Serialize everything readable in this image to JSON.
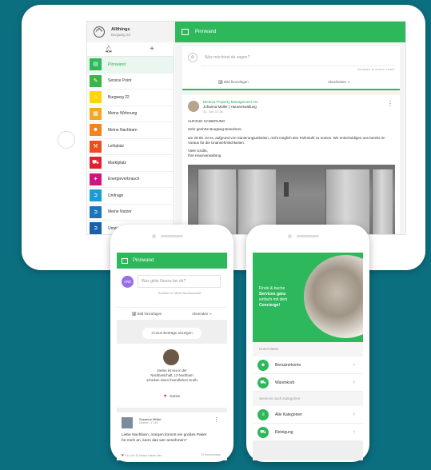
{
  "tablet": {
    "community_name": "Allthings",
    "community_address": "Burgweg 22",
    "nav_items": [
      {
        "label": "Pinnwand",
        "icon": "bulletin-icon",
        "color": "#2eb85c",
        "glyph": "▤"
      },
      {
        "label": "Service Point",
        "icon": "service-icon",
        "color": "#39b54a",
        "glyph": "✎"
      },
      {
        "label": "Burgweg 22",
        "icon": "house-icon",
        "color": "#ffd500",
        "glyph": "⌂"
      },
      {
        "label": "Meine Wohnung",
        "icon": "apartment-icon",
        "color": "#f5a623",
        "glyph": "▦"
      },
      {
        "label": "Meine Nachbarn",
        "icon": "neighbors-icon",
        "color": "#f58220",
        "glyph": "☻"
      },
      {
        "label": "Leihplatz",
        "icon": "lending-icon",
        "color": "#e94e1b",
        "glyph": "⚒"
      },
      {
        "label": "Marktplatz",
        "icon": "market-icon",
        "color": "#e5202e",
        "glyph": "⛟"
      },
      {
        "label": "Energieverbrauch",
        "icon": "energy-icon",
        "color": "#d0157f",
        "glyph": "✦"
      },
      {
        "label": "Umfrage",
        "icon": "survey-icon",
        "color": "#1c9bd7",
        "glyph": "➲"
      },
      {
        "label": "Meine Nutzer",
        "icon": "users-icon",
        "color": "#1b75bc",
        "glyph": "➲"
      },
      {
        "label": "Umzug & B",
        "icon": "move-icon",
        "color": "#1b5fa8",
        "glyph": "➲"
      }
    ],
    "header_title": "Pinnwand",
    "composer": {
      "placeholder": "Was möchtest du sagen?",
      "scope": "Schicken 'in einer/n Listen'",
      "photo": "Bild hinzufügen",
      "send": "Abschicken"
    },
    "post": {
      "org": "Beneva Property Management AG",
      "author": "Johanna Müller | Hausverwaltung",
      "date": "31. Juli, 17:34",
      "subject": "AUFZUG SANIERUNG",
      "greeting": "Sehr geehrte Burgweg Bewohner,",
      "body": "am 29.09. ist es, aufgrund von Sanierungsarbeiten, nicht möglich den Fahrstuhl zu nutzen. Wir entschuldigen uns bereits im Voraus für die Unannehmlichkeiten.",
      "closing": "Viele Grüße,",
      "signature": "Ihre Hausverwaltung"
    }
  },
  "phone1": {
    "header_title": "Pinnwand",
    "avatar_initials": "ARE",
    "placeholder": "Was gibts Neues bei dir?",
    "scope": "Schicken in \"Meine Nachbarschaft\"",
    "photo": "Bild hinzufügen",
    "send": "Absenden",
    "new_posts": "3 neue Beiträge anzeigen",
    "welcome": [
      "Janine ist neu in der",
      "Nachbarschaft, 12 Nachbarn",
      "schicken einen freundlichen Gruß!"
    ],
    "thanks": "Danke",
    "post": {
      "name": "Susanne Müller",
      "date": "Gestern, 17:48",
      "text": "Liebe Nachbarn, morgen kommt ein großes Paket für mich an, kann das wer annehmen?",
      "likes": "Du und 15 Nutzer haben dies",
      "comments": "13 Kommentare"
    }
  },
  "phone2": {
    "hero_lines": [
      "Finde & buche",
      "Services ganz",
      "einfach mit dem",
      "Concierge!"
    ],
    "section1": "Nutzerdaten",
    "rows1": [
      {
        "label": "Benutzerkonto",
        "icon": "account-icon",
        "glyph": "☻"
      },
      {
        "label": "Warenkorb",
        "icon": "cart-icon",
        "glyph": "⛟"
      }
    ],
    "section2": "Services nach Kategorien",
    "rows2": [
      {
        "label": "Alle Kategorien",
        "icon": "categories-icon",
        "glyph": "≡"
      },
      {
        "label": "Reinigung",
        "icon": "cleaning-icon",
        "glyph": "⛟"
      }
    ]
  },
  "colors": {
    "background": "#0b6f80",
    "accent": "#2eb85c"
  }
}
